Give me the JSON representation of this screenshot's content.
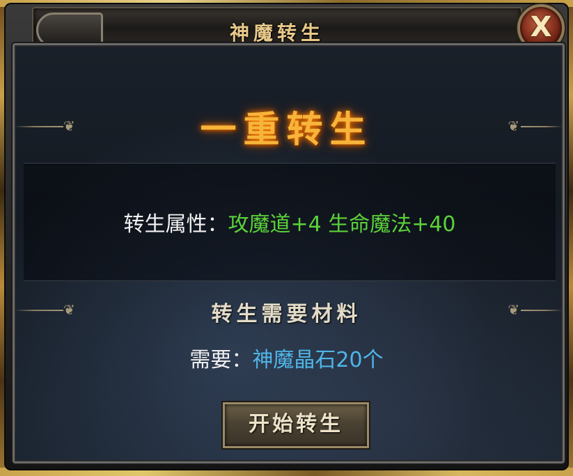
{
  "window": {
    "title": "神魔转生",
    "close_label": "X"
  },
  "rebirth": {
    "rank_title": "一重转生",
    "attr_label": "转生属性：",
    "attr_value": "攻魔道+4 生命魔法+40",
    "materials_title": "转生需要材料",
    "need_label": "需要：",
    "need_value": "神魔晶石20个",
    "start_button": "开始转生"
  },
  "colors": {
    "title_gold": "#e8c98a",
    "rank_orange": "#f7b43a",
    "attr_green": "#5bd23a",
    "material_blue": "#4fb6e8"
  }
}
